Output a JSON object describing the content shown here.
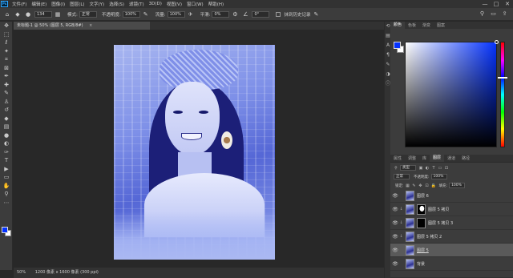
{
  "menubar": {
    "logo": "Ps",
    "items": [
      "文件(F)",
      "编辑(E)",
      "图像(I)",
      "图层(L)",
      "文字(Y)",
      "选择(S)",
      "滤镜(T)",
      "3D(D)",
      "视图(V)",
      "窗口(W)",
      "帮助(H)"
    ],
    "minimize": "—",
    "maximize": "□",
    "close": "✕"
  },
  "options": {
    "brush_size": "134",
    "mode_label": "模式:",
    "mode_value": "正常",
    "opacity_label": "不透明度:",
    "opacity_value": "100%",
    "flow_label": "流量:",
    "flow_value": "100%",
    "smooth_label": "平滑:",
    "smooth_value": "0%",
    "angle_value": "0°",
    "erase_history_label": "抹到历史记录"
  },
  "document": {
    "tab_title": "未标题-1 @ 50% (图层 5, RGB/8#)",
    "tab_close": "×"
  },
  "status": {
    "zoom": "50%",
    "info": "1200 像素 x 1600 像素 (300 ppi)"
  },
  "color_panel": {
    "tabs": [
      "颜色",
      "色板",
      "渐变",
      "图案"
    ],
    "active_tab": 0,
    "foreground": "#0432ff",
    "background": "#ffffff"
  },
  "layers_panel": {
    "tabs": [
      "属性",
      "调整",
      "库",
      "图层",
      "通道",
      "路径"
    ],
    "active_tab": 3,
    "filter_label": "类型",
    "blend_mode": "正常",
    "opacity_label": "不透明度:",
    "opacity_value": "100%",
    "lock_label": "锁定:",
    "fill_label": "填充:",
    "fill_value": "100%",
    "layers": [
      {
        "name": "图层 6",
        "mask": "none",
        "clipped": false,
        "selected": false,
        "underline": false
      },
      {
        "name": "图层 5 拷贝",
        "mask": "white",
        "clipped": true,
        "selected": false,
        "underline": false
      },
      {
        "name": "图层 5 拷贝 3",
        "mask": "black",
        "clipped": true,
        "selected": false,
        "underline": false
      },
      {
        "name": "图层 5 拷贝 2",
        "mask": "none",
        "clipped": true,
        "selected": false,
        "underline": false
      },
      {
        "name": "图层 5",
        "mask": "none",
        "clipped": false,
        "selected": true,
        "underline": true
      },
      {
        "name": "背景",
        "mask": "none",
        "clipped": false,
        "selected": false,
        "underline": false
      }
    ]
  }
}
